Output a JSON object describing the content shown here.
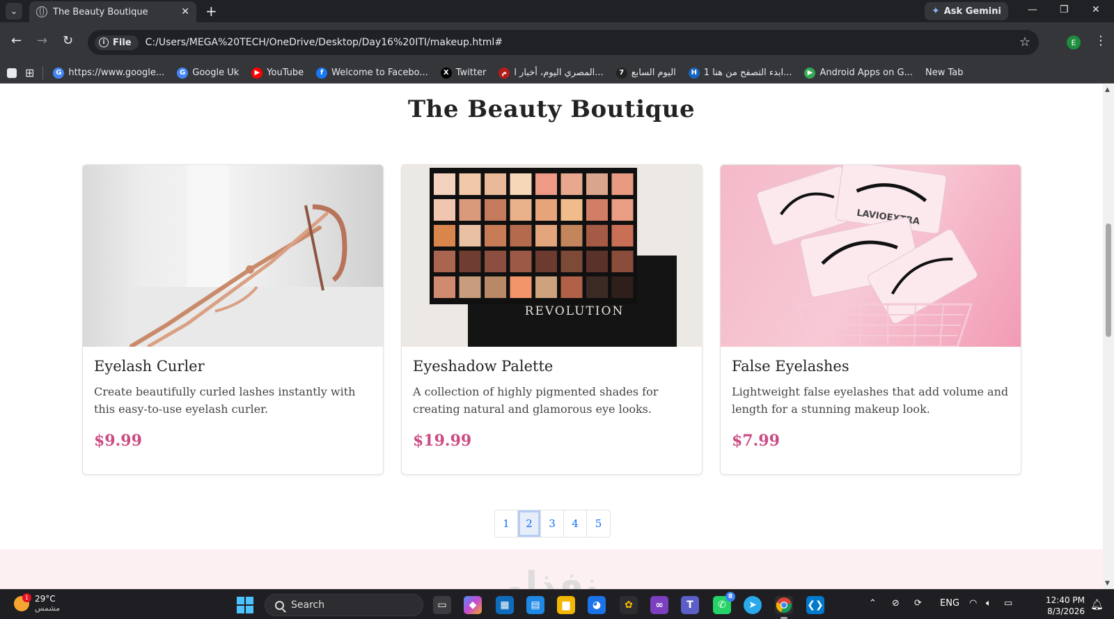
{
  "browser": {
    "tab_title": "The Beauty Boutique",
    "ask_gemini": "Ask Gemini",
    "file_chip": "File",
    "url": "C:/Users/MEGA%20TECH/OneDrive/Desktop/Day16%20ITI/makeup.html#",
    "profile_initial": "E",
    "bookmarks": [
      {
        "label": "https://www.google...",
        "icon": "google-icon",
        "icon_text": "G",
        "color": "#4285f4"
      },
      {
        "label": "Google Uk",
        "icon": "google-icon",
        "icon_text": "G",
        "color": "#4285f4"
      },
      {
        "label": "YouTube",
        "icon": "youtube-icon",
        "icon_text": "▶",
        "color": "#ff0000"
      },
      {
        "label": "Welcome to Facebo...",
        "icon": "facebook-icon",
        "icon_text": "f",
        "color": "#1877f2"
      },
      {
        "label": "Twitter",
        "icon": "x-icon",
        "icon_text": "X",
        "color": "#000000"
      },
      {
        "label": "المصري اليوم، أخبار ا...",
        "icon": "news-icon",
        "icon_text": "م",
        "color": "#b71c1c"
      },
      {
        "label": "اليوم السابع",
        "icon": "news-icon",
        "icon_text": "7",
        "color": "#222222"
      },
      {
        "label": "ابدء التصفح من هنا 1...",
        "icon": "news-icon",
        "icon_text": "H",
        "color": "#1565c0"
      },
      {
        "label": "Android Apps on G...",
        "icon": "play-store-icon",
        "icon_text": "▶",
        "color": "#34a853"
      },
      {
        "label": "New Tab",
        "icon": "",
        "icon_text": "",
        "color": ""
      }
    ]
  },
  "page": {
    "title": "The Beauty Boutique",
    "products": [
      {
        "name": "Eyelash Curler",
        "description": "Create beautifully curled lashes instantly with this easy-to-use eyelash curler.",
        "price": "$9.99"
      },
      {
        "name": "Eyeshadow Palette",
        "description": "A collection of highly pigmented shades for creating natural and glamorous eye looks.",
        "price": "$19.99"
      },
      {
        "name": "False Eyelashes",
        "description": "Lightweight false eyelashes that add volume and length for a stunning makeup look.",
        "price": "$7.99"
      }
    ],
    "pagination": [
      "1",
      "2",
      "3",
      "4",
      "5"
    ],
    "active_page": "2",
    "palette_brand": "REVOLUTION",
    "lash_brand": "LAVIOEXTRA",
    "watermark": "نفذلي"
  },
  "taskbar": {
    "temperature": "29°C",
    "weather_desc": "مشمس",
    "weather_badge": "1",
    "search_label": "Search",
    "whatsapp_badge": "8",
    "language": "ENG",
    "time": "12:40 PM",
    "date": "8/3/2026"
  },
  "colors": {
    "accent_price": "#cc4b84",
    "link_blue": "#0d6efd"
  }
}
